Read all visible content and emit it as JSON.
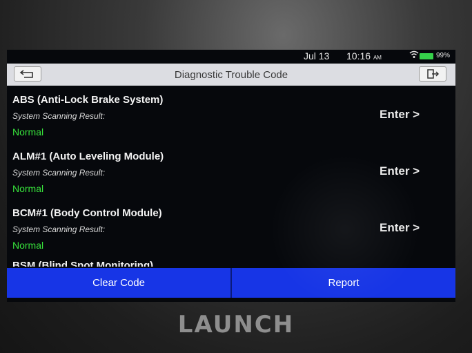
{
  "status_bar": {
    "date": "Jul 13",
    "time": "10:16",
    "ampm": "AM",
    "battery_percent": "99%"
  },
  "header": {
    "title": "Diagnostic Trouble Code"
  },
  "systems": [
    {
      "name": "ABS (Anti-Lock Brake System)",
      "scan_label": "System Scanning Result:",
      "status": "Normal",
      "enter_label": "Enter >"
    },
    {
      "name": "ALM#1 (Auto Leveling Module)",
      "scan_label": "System Scanning Result:",
      "status": "Normal",
      "enter_label": "Enter >"
    },
    {
      "name": "BCM#1 (Body Control Module)",
      "scan_label": "System Scanning Result:",
      "status": "Normal",
      "enter_label": "Enter >"
    },
    {
      "name": "BSM (Blind Spot Monitoring)"
    }
  ],
  "footer": {
    "clear_code_label": "Clear Code",
    "report_label": "Report"
  },
  "device": {
    "brand": "LAUNCH"
  },
  "colors": {
    "status_normal": "#38e43c",
    "button_blue": "#1735e6",
    "title_bar": "#dcdde2"
  }
}
